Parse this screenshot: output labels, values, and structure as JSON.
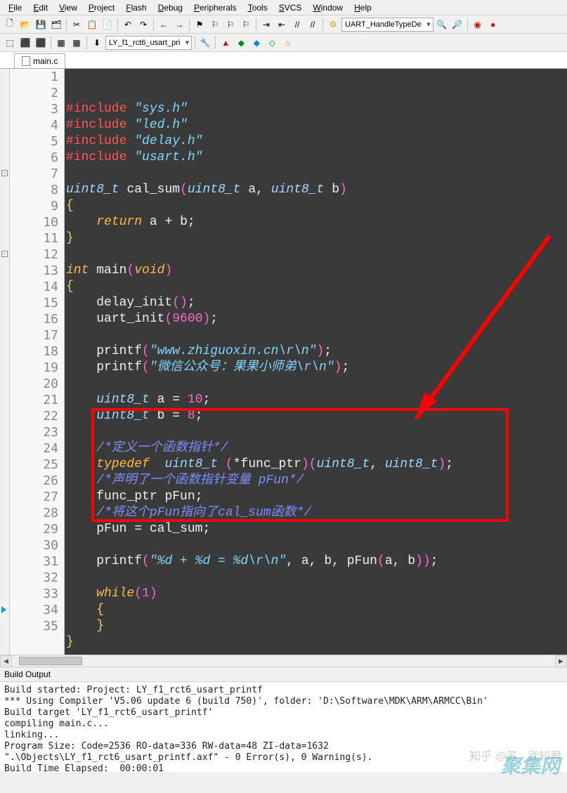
{
  "menu": {
    "items": [
      "File",
      "Edit",
      "View",
      "Project",
      "Flash",
      "Debug",
      "Peripherals",
      "Tools",
      "SVCS",
      "Window",
      "Help"
    ]
  },
  "toolbar1": {
    "combo": "UART_HandleTypeDe"
  },
  "toolbar2": {
    "project_combo": "LY_f1_rct6_usart_pri"
  },
  "tab": {
    "name": "main.c"
  },
  "code": {
    "lines": [
      {
        "n": 1,
        "seg": [
          [
            "pp",
            "#include"
          ],
          [
            "sp",
            " "
          ],
          [
            "str",
            "\"sys.h\""
          ]
        ]
      },
      {
        "n": 2,
        "seg": [
          [
            "pp",
            "#include"
          ],
          [
            "sp",
            " "
          ],
          [
            "str",
            "\"led.h\""
          ]
        ]
      },
      {
        "n": 3,
        "seg": [
          [
            "pp",
            "#include"
          ],
          [
            "sp",
            " "
          ],
          [
            "str",
            "\"delay.h\""
          ]
        ]
      },
      {
        "n": 4,
        "seg": [
          [
            "pp",
            "#include"
          ],
          [
            "sp",
            " "
          ],
          [
            "str",
            "\"usart.h\""
          ]
        ]
      },
      {
        "n": 5,
        "seg": []
      },
      {
        "n": 6,
        "seg": [
          [
            "type",
            "uint8_t"
          ],
          [
            "sp",
            " "
          ],
          [
            "id",
            "cal_sum"
          ],
          [
            "pn",
            "("
          ],
          [
            "type",
            "uint8_t"
          ],
          [
            "sp",
            " "
          ],
          [
            "id",
            "a"
          ],
          [
            "op",
            ","
          ],
          [
            "sp",
            " "
          ],
          [
            "type",
            "uint8_t"
          ],
          [
            "sp",
            " "
          ],
          [
            "id",
            "b"
          ],
          [
            "pn",
            ")"
          ]
        ]
      },
      {
        "n": 7,
        "fold": "-",
        "seg": [
          [
            "br",
            "{"
          ]
        ]
      },
      {
        "n": 8,
        "seg": [
          [
            "sp",
            "    "
          ],
          [
            "kw",
            "return"
          ],
          [
            "sp",
            " "
          ],
          [
            "id",
            "a"
          ],
          [
            "sp",
            " "
          ],
          [
            "op",
            "+"
          ],
          [
            "sp",
            " "
          ],
          [
            "id",
            "b"
          ],
          [
            "op",
            ";"
          ]
        ]
      },
      {
        "n": 9,
        "seg": [
          [
            "br",
            "}"
          ]
        ]
      },
      {
        "n": 10,
        "seg": []
      },
      {
        "n": 11,
        "seg": [
          [
            "kw",
            "int"
          ],
          [
            "sp",
            " "
          ],
          [
            "id",
            "main"
          ],
          [
            "pn",
            "("
          ],
          [
            "kw",
            "void"
          ],
          [
            "pn",
            ")"
          ]
        ]
      },
      {
        "n": 12,
        "fold": "-",
        "seg": [
          [
            "br",
            "{"
          ]
        ]
      },
      {
        "n": 13,
        "seg": [
          [
            "sp",
            "    "
          ],
          [
            "id",
            "delay_init"
          ],
          [
            "pn",
            "()"
          ],
          [
            "op",
            ";"
          ]
        ]
      },
      {
        "n": 14,
        "seg": [
          [
            "sp",
            "    "
          ],
          [
            "id",
            "uart_init"
          ],
          [
            "pn",
            "("
          ],
          [
            "num",
            "9600"
          ],
          [
            "pn",
            ")"
          ],
          [
            "op",
            ";"
          ]
        ]
      },
      {
        "n": 15,
        "seg": []
      },
      {
        "n": 16,
        "seg": [
          [
            "sp",
            "    "
          ],
          [
            "id",
            "printf"
          ],
          [
            "pn",
            "("
          ],
          [
            "str",
            "\"www.zhiguoxin.cn\\r\\n\""
          ],
          [
            "pn",
            ")"
          ],
          [
            "op",
            ";"
          ]
        ]
      },
      {
        "n": 17,
        "seg": [
          [
            "sp",
            "    "
          ],
          [
            "id",
            "printf"
          ],
          [
            "pn",
            "("
          ],
          [
            "str",
            "\"微信公众号：果果小师弟\\r\\n\""
          ],
          [
            "pn",
            ")"
          ],
          [
            "op",
            ";"
          ]
        ]
      },
      {
        "n": 18,
        "seg": []
      },
      {
        "n": 19,
        "seg": [
          [
            "sp",
            "    "
          ],
          [
            "type",
            "uint8_t"
          ],
          [
            "sp",
            " "
          ],
          [
            "id",
            "a"
          ],
          [
            "sp",
            " "
          ],
          [
            "op",
            "="
          ],
          [
            "sp",
            " "
          ],
          [
            "num",
            "10"
          ],
          [
            "op",
            ";"
          ]
        ]
      },
      {
        "n": 20,
        "seg": [
          [
            "sp",
            "    "
          ],
          [
            "type",
            "uint8_t"
          ],
          [
            "sp",
            " "
          ],
          [
            "id",
            "b"
          ],
          [
            "sp",
            " "
          ],
          [
            "op",
            "="
          ],
          [
            "sp",
            " "
          ],
          [
            "num",
            "8"
          ],
          [
            "op",
            ";"
          ]
        ]
      },
      {
        "n": 21,
        "seg": []
      },
      {
        "n": 22,
        "seg": [
          [
            "sp",
            "    "
          ],
          [
            "cmt",
            "/*定义一个函数指针*/"
          ]
        ]
      },
      {
        "n": 23,
        "seg": [
          [
            "sp",
            "    "
          ],
          [
            "kw",
            "typedef"
          ],
          [
            "sp",
            "  "
          ],
          [
            "type",
            "uint8_t"
          ],
          [
            "sp",
            " "
          ],
          [
            "pn",
            "("
          ],
          [
            "op",
            "*"
          ],
          [
            "id",
            "func_ptr"
          ],
          [
            "pn",
            ")"
          ],
          [
            "pn",
            "("
          ],
          [
            "type",
            "uint8_t"
          ],
          [
            "op",
            ","
          ],
          [
            "sp",
            " "
          ],
          [
            "type",
            "uint8_t"
          ],
          [
            "pn",
            ")"
          ],
          [
            "op",
            ";"
          ]
        ]
      },
      {
        "n": 24,
        "seg": [
          [
            "sp",
            "    "
          ],
          [
            "cmt",
            "/*声明了一个函数指针变量 pFun*/"
          ]
        ]
      },
      {
        "n": 25,
        "seg": [
          [
            "sp",
            "    "
          ],
          [
            "id",
            "func_ptr"
          ],
          [
            "sp",
            " "
          ],
          [
            "id",
            "pFun"
          ],
          [
            "op",
            ";"
          ]
        ]
      },
      {
        "n": 26,
        "seg": [
          [
            "sp",
            "    "
          ],
          [
            "cmt",
            "/*将这个pFun指向了cal_sum函数*/"
          ]
        ]
      },
      {
        "n": 27,
        "seg": [
          [
            "sp",
            "    "
          ],
          [
            "id",
            "pFun"
          ],
          [
            "sp",
            " "
          ],
          [
            "op",
            "="
          ],
          [
            "sp",
            " "
          ],
          [
            "id",
            "cal_sum"
          ],
          [
            "op",
            ";"
          ]
        ]
      },
      {
        "n": 28,
        "seg": []
      },
      {
        "n": 29,
        "seg": [
          [
            "sp",
            "    "
          ],
          [
            "id",
            "printf"
          ],
          [
            "pn",
            "("
          ],
          [
            "str",
            "\"%d + %d = %d\\r\\n\""
          ],
          [
            "op",
            ","
          ],
          [
            "sp",
            " "
          ],
          [
            "id",
            "a"
          ],
          [
            "op",
            ","
          ],
          [
            "sp",
            " "
          ],
          [
            "id",
            "b"
          ],
          [
            "op",
            ","
          ],
          [
            "sp",
            " "
          ],
          [
            "id",
            "pFun"
          ],
          [
            "pn",
            "("
          ],
          [
            "id",
            "a"
          ],
          [
            "op",
            ","
          ],
          [
            "sp",
            " "
          ],
          [
            "id",
            "b"
          ],
          [
            "pn",
            "))"
          ],
          [
            "op",
            ";"
          ]
        ]
      },
      {
        "n": 30,
        "seg": []
      },
      {
        "n": 31,
        "seg": [
          [
            "sp",
            "    "
          ],
          [
            "kw",
            "while"
          ],
          [
            "pn",
            "("
          ],
          [
            "num",
            "1"
          ],
          [
            "pn",
            ")"
          ]
        ]
      },
      {
        "n": 32,
        "seg": [
          [
            "sp",
            "    "
          ],
          [
            "br",
            "{"
          ]
        ]
      },
      {
        "n": 33,
        "seg": [
          [
            "sp",
            "    "
          ],
          [
            "br",
            "}"
          ]
        ]
      },
      {
        "n": 34,
        "bm": true,
        "seg": [
          [
            "br",
            "}"
          ]
        ]
      },
      {
        "n": 35,
        "seg": []
      }
    ]
  },
  "output": {
    "title": "Build Output",
    "lines": [
      "Build started: Project: LY_f1_rct6_usart_printf",
      "*** Using Compiler 'V5.06 update 6 (build 750)', folder: 'D:\\Software\\MDK\\ARM\\ARMCC\\Bin'",
      "Build target 'LY_f1_rct6_usart_printf'",
      "compiling main.c...",
      "linking...",
      "Program Size: Code=2536 RO-data=336 RW-data=48 ZI-data=1632",
      "\".\\Objects\\LY_f1_rct6_usart_printf.axf\" - 0 Error(s), 0 Warning(s).",
      "Build Time Elapsed:  00:00:01"
    ]
  },
  "watermark": {
    "site": "聚集网",
    "zhihu": "知乎 @苏 · 武知君"
  },
  "icons": {
    "new": "🗋",
    "open": "📂",
    "save": "💾",
    "saveall": "🗂",
    "cut": "✂",
    "copy": "📋",
    "paste": "📄",
    "undo": "↶",
    "redo": "↷",
    "back": "←",
    "fwd": "→",
    "flag": "⚑",
    "indent": "⇥",
    "outdent": "⇤",
    "find": "🔍",
    "debug": "▶",
    "stop": "■"
  }
}
